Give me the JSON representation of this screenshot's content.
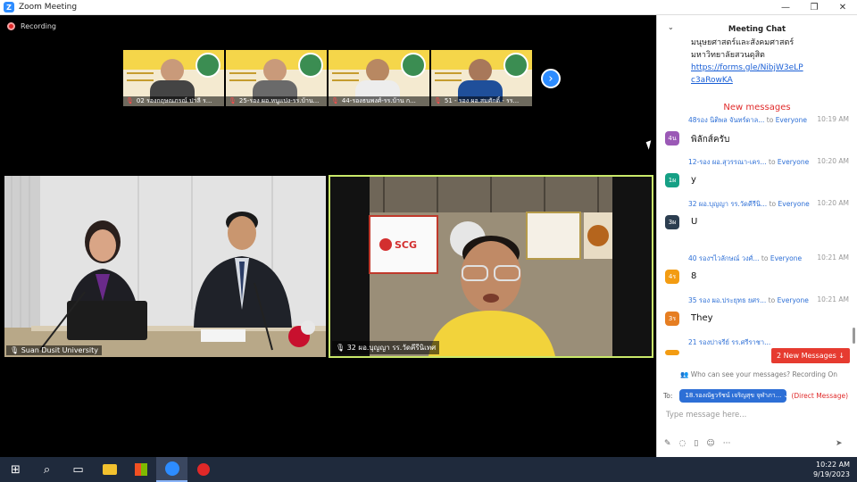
{
  "window": {
    "title": "Zoom Meeting",
    "min": "—",
    "restore": "❐",
    "close": "✕"
  },
  "recording": {
    "label": "Recording"
  },
  "thumbnails": [
    {
      "name": "02 รองกฤษณภรณ์ ปาลี ร..."
    },
    {
      "name": "25-รอง ผอ.หนูแปง-รร.บ้าน..."
    },
    {
      "name": "44-รองธนพงศ์-รร.บ้าน ก..."
    },
    {
      "name": "51 - รอง ผอ.สมศักดิ์ - รร..."
    }
  ],
  "next_thumbs_icon": "chevron-right-icon",
  "tiles": {
    "left": {
      "name": "Suan Dusit University"
    },
    "right": {
      "name": "32 ผอ.บุญญา รร.วัดคีรีนิเทศ"
    }
  },
  "chat": {
    "title": "Meeting Chat",
    "collapse_icon": "chevron-down-icon",
    "pre_lines": [
      "มนุษยศาสตร์และสังคมศาสตร์",
      "มหาวิทยาลัยสวนดุสิต"
    ],
    "link": "https://forms.gle/NibjW3eLPc3aRowKA",
    "link_parts": [
      "https://forms.gle/NibjW3eLP",
      "c3aRowKA"
    ],
    "new_messages_label": "New messages",
    "messages": [
      {
        "sender": "48รอง นิติพล จันทร์ดาล...",
        "to": "to",
        "audience": "Everyone",
        "time": "10:19 AM",
        "avatar": "4น",
        "color": "#9b59b6",
        "text": "พิลักส์ครับ"
      },
      {
        "sender": "12-รอง ผอ.สุวรรณา-เคร...",
        "to": "to",
        "audience": "Everyone",
        "time": "10:20 AM",
        "avatar": "1ผ",
        "color": "#16a085",
        "text": "y"
      },
      {
        "sender": "32 ผอ.บุญญา รร.วัดคีรีนิ...",
        "to": "to",
        "audience": "Everyone",
        "time": "10:20 AM",
        "avatar": "3ผ",
        "color": "#2c3e50",
        "text": "U"
      },
      {
        "sender": "40 รองฯไวลักษณ์ วงศ์...",
        "to": "to",
        "audience": "Everyone",
        "time": "10:21 AM",
        "avatar": "4ร",
        "color": "#f39c12",
        "text": "8"
      },
      {
        "sender": "35 รอง ผอ.ประยุทธ ยศร...",
        "to": "to",
        "audience": "Everyone",
        "time": "10:21 AM",
        "avatar": "3ร",
        "color": "#e67e22",
        "text": "They"
      },
      {
        "sender": "21 รองปาจรีย์ รร.ศรีราชา...",
        "to": "",
        "audience": "",
        "time": "",
        "avatar": "",
        "color": "#f39c12",
        "text": ""
      }
    ],
    "new_badge": "2 New Messages ↓",
    "who_can_see": "Who can see your messages? Recording On",
    "to_label": "To:",
    "recipient": "18.รองณัฐวรัชน์ เจริญสุข จุฬาภา...",
    "direct_message": "(Direct Message)",
    "input_placeholder": "Type message here...",
    "tool_icons": [
      "pen-icon",
      "screenshot-icon",
      "file-icon",
      "emoji-icon",
      "more-icon"
    ],
    "send_icon": "send-icon"
  },
  "taskbar": {
    "apps": [
      "windows-start-icon",
      "search-icon",
      "task-view-icon",
      "file-explorer-icon",
      "store-icon",
      "zoom-icon",
      "app-icon"
    ],
    "time": "10:22 AM",
    "date": "9/19/2023"
  }
}
